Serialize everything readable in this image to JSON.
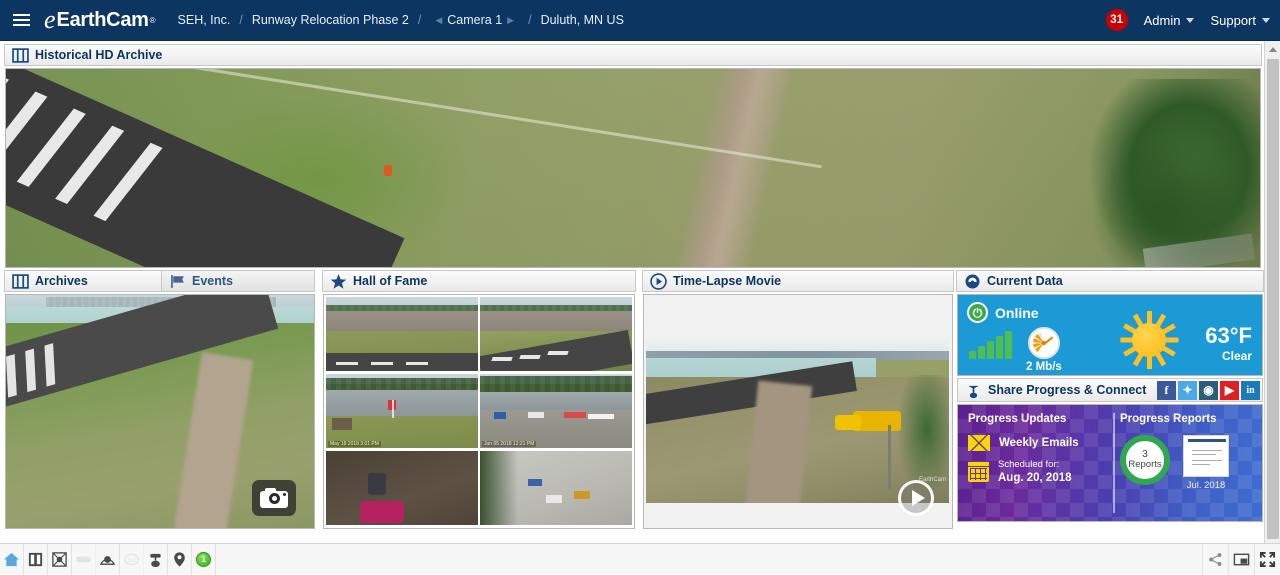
{
  "header": {
    "menu_icon": "hamburger-menu-icon",
    "logo_text": "EarthCam",
    "logo_mark": "e",
    "logo_tm": "®",
    "breadcrumb": {
      "company": "SEH, Inc.",
      "project": "Runway Relocation Phase 2",
      "camera": "Camera 1",
      "location": "Duluth, MN US",
      "separator": "/",
      "prev_arrow": "◀",
      "next_arrow": "▶"
    },
    "notification_count": "31",
    "admin_label": "Admin",
    "support_label": "Support"
  },
  "hd_archive": {
    "title": "Historical HD Archive",
    "icon": "filmstrip-icon"
  },
  "archives": {
    "tab_archives": "Archives",
    "tab_events": "Events",
    "archives_icon": "filmstrip-icon",
    "events_icon": "flag-icon",
    "camera_button": "camera-icon"
  },
  "hall_of_fame": {
    "title": "Hall of Fame",
    "icon": "star-icon",
    "thumbnails": [
      {
        "caption": ""
      },
      {
        "caption": ""
      },
      {
        "caption": "May 18 2018 3:01 PM"
      },
      {
        "caption": "Jun 05 2018 12:21 PM"
      },
      {
        "caption": ""
      },
      {
        "caption": ""
      }
    ]
  },
  "time_lapse": {
    "title": "Time-Lapse Movie",
    "icon": "play-circle-icon",
    "play_button": "play-icon",
    "watermark": "EarthCam"
  },
  "current_data": {
    "title": "Current Data",
    "icon": "weather-icon",
    "status": "Online",
    "status_icon": "power-icon",
    "signal_icon": "signal-bars-icon",
    "bandwidth": "2 Mb/s",
    "gauge_icon": "speedometer-icon",
    "weather_icon": "sun-icon",
    "temperature": "63°F",
    "condition": "Clear"
  },
  "share": {
    "title": "Share Progress & Connect",
    "icon": "share-connect-icon",
    "networks": [
      {
        "name": "facebook",
        "glyph": "f"
      },
      {
        "name": "twitter",
        "glyph": "✦"
      },
      {
        "name": "instagram",
        "glyph": "◉"
      },
      {
        "name": "youtube",
        "glyph": "▶"
      },
      {
        "name": "linkedin",
        "glyph": "in"
      }
    ]
  },
  "progress": {
    "updates_title": "Progress Updates",
    "reports_title": "Progress Reports",
    "email_label": "Weekly Emails",
    "email_icon": "envelope-icon",
    "calendar_icon": "calendar-icon",
    "scheduled_label": "Scheduled for:",
    "scheduled_date": "Aug. 20, 2018",
    "reports_count": "3",
    "reports_word": "Reports",
    "report_month": "Jul. 2018"
  },
  "toolbar": {
    "left": [
      {
        "name": "home-icon",
        "label": "Home",
        "enabled": true
      },
      {
        "name": "filmstrip-icon",
        "label": "Archive",
        "enabled": true
      },
      {
        "name": "mosaic-icon",
        "label": "Mosaic",
        "enabled": true
      },
      {
        "name": "panorama-icon",
        "label": "Panorama",
        "enabled": false
      },
      {
        "name": "webcam-icon",
        "label": "Live Camera",
        "enabled": true
      },
      {
        "name": "360-icon",
        "label": "360 View",
        "enabled": false
      },
      {
        "name": "timelapse-camera-icon",
        "label": "Time-Lapse",
        "enabled": true
      },
      {
        "name": "map-pin-icon",
        "label": "Map Location",
        "enabled": true
      },
      {
        "name": "camera-count-badge",
        "label": "1",
        "enabled": true
      }
    ],
    "right": [
      {
        "name": "share-icon",
        "label": "Share",
        "enabled": true
      },
      {
        "name": "picture-in-picture-icon",
        "label": "Picture in Picture",
        "enabled": true
      },
      {
        "name": "fullscreen-icon",
        "label": "Fullscreen",
        "enabled": true
      }
    ],
    "camera_count": "1"
  },
  "colors": {
    "header_bg": "#0d3562",
    "accent_blue": "#1c9ad6",
    "badge_red": "#cc0000",
    "online_green": "#3faa4a",
    "progress_purple": "#5b1f8f",
    "progress_blue": "#3d6ed0"
  }
}
